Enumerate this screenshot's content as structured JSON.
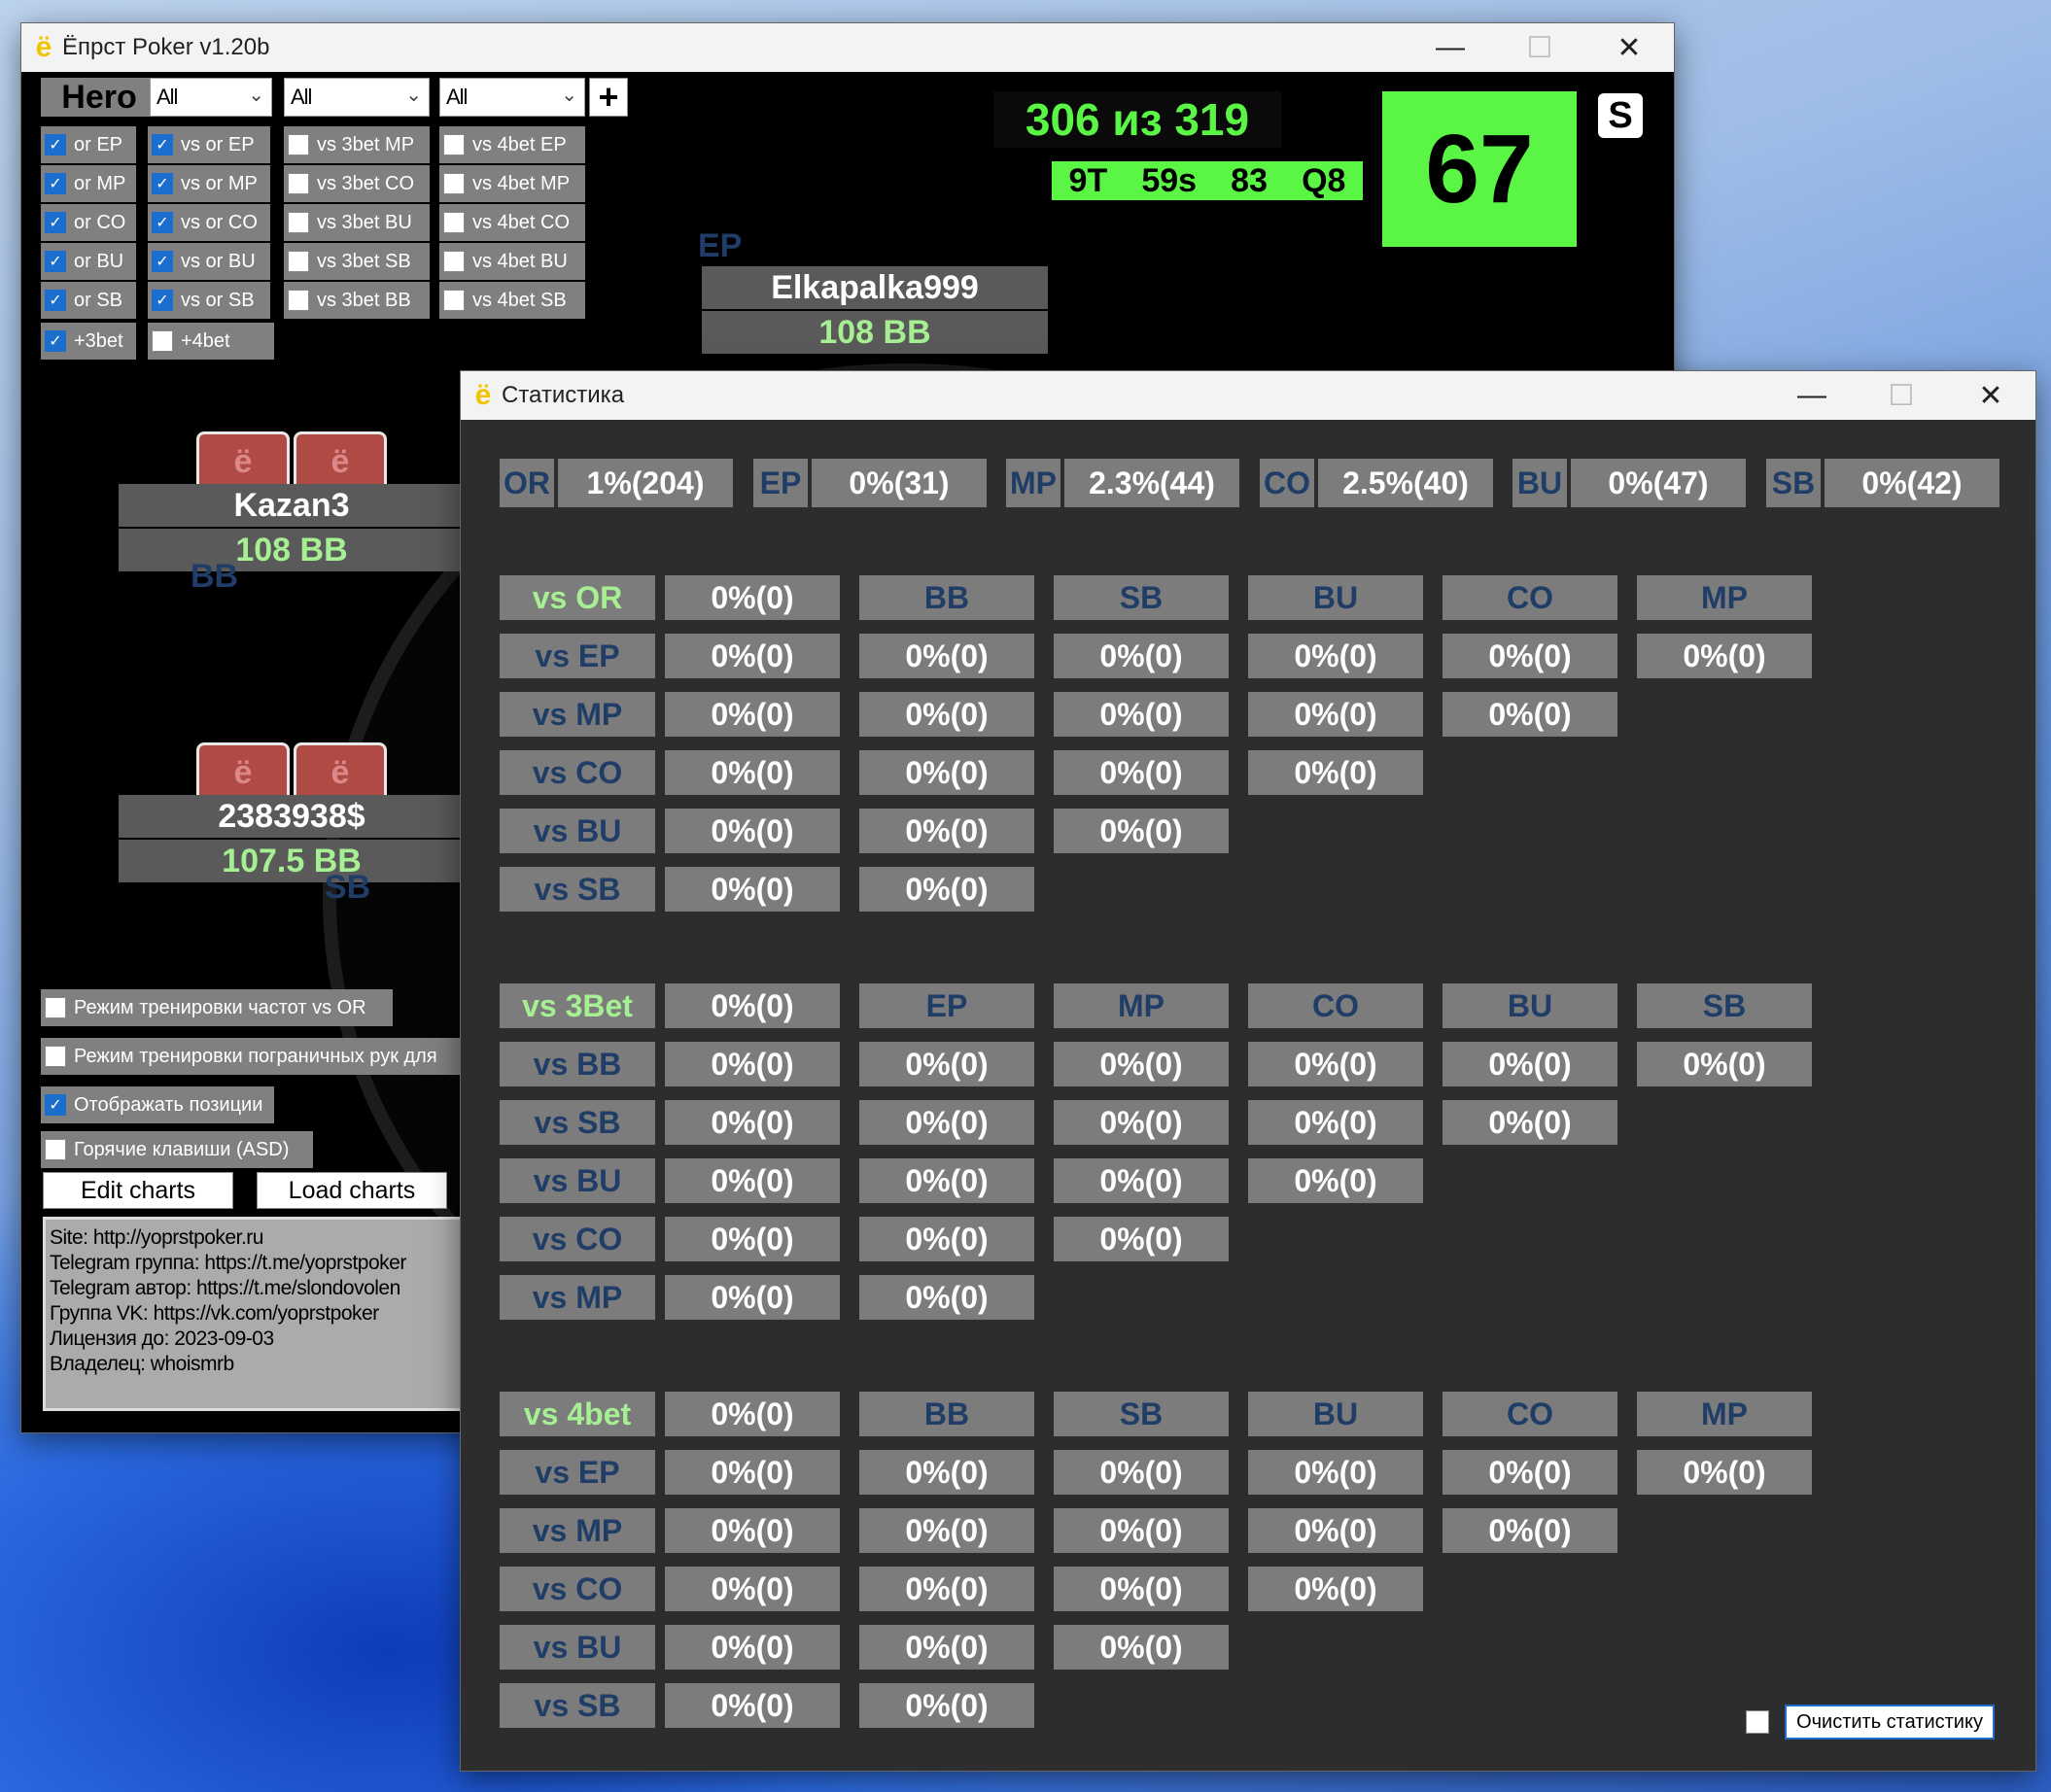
{
  "main_window": {
    "title": "Ёпрст Poker v1.20b",
    "hero_label": "Hero",
    "add_symbol": "+",
    "dropdowns": [
      "All",
      "All",
      "All"
    ],
    "col1": [
      {
        "label": "or EP",
        "checked": true
      },
      {
        "label": "or MP",
        "checked": true
      },
      {
        "label": "or CO",
        "checked": true
      },
      {
        "label": "or BU",
        "checked": true
      },
      {
        "label": "or SB",
        "checked": true
      }
    ],
    "col2": [
      {
        "label": "vs or EP",
        "checked": true
      },
      {
        "label": "vs or MP",
        "checked": true
      },
      {
        "label": "vs or CO",
        "checked": true
      },
      {
        "label": "vs or BU",
        "checked": true
      },
      {
        "label": "vs or SB",
        "checked": true
      }
    ],
    "col3": [
      {
        "label": "vs 3bet MP",
        "checked": false
      },
      {
        "label": "vs 3bet CO",
        "checked": false
      },
      {
        "label": "vs 3bet BU",
        "checked": false
      },
      {
        "label": "vs 3bet SB",
        "checked": false
      },
      {
        "label": "vs 3bet BB",
        "checked": false
      }
    ],
    "col4": [
      {
        "label": "vs 4bet EP",
        "checked": false
      },
      {
        "label": "vs 4bet MP",
        "checked": false
      },
      {
        "label": "vs 4bet CO",
        "checked": false
      },
      {
        "label": "vs 4bet BU",
        "checked": false
      },
      {
        "label": "vs 4bet SB",
        "checked": false
      }
    ],
    "extra": [
      {
        "label": "+3bet",
        "checked": true
      },
      {
        "label": "+4bet",
        "checked": false
      }
    ],
    "progress": "306 из 319",
    "hand_info": [
      "9T",
      "59s",
      "83",
      "Q8"
    ],
    "score": "67",
    "s_button": "S",
    "players": [
      {
        "name": "Elkapalka999",
        "stack": "108 BB",
        "position": "EP"
      },
      {
        "name": "Kazan3",
        "stack": "108 BB",
        "position": "BB"
      },
      {
        "name": "2383938$",
        "stack": "107.5 BB",
        "position": "SB"
      }
    ],
    "card_glyph": "ё",
    "options": [
      {
        "label": "Режим тренировки частот vs OR",
        "checked": false
      },
      {
        "label": "Режим тренировки пограничных рук для",
        "checked": false
      },
      {
        "label": "Отображать позиции",
        "checked": true
      },
      {
        "label": "Горячие клавиши (ASD)",
        "checked": false
      }
    ],
    "edit_charts": "Edit charts",
    "load_charts": "Load charts",
    "info_lines": [
      "Site: http://yoprstpoker.ru",
      "Telegram группа: https://t.me/yoprstpoker",
      "Telegram автор: https://t.me/slondovolen",
      "Группа VK: https://vk.com/yoprstpoker",
      "Лицензия до: 2023-09-03",
      "Владелец: whoismrb"
    ]
  },
  "stats_window": {
    "title": "Статистика",
    "summary": [
      {
        "pos": "OR",
        "val": "1%(204)"
      },
      {
        "pos": "EP",
        "val": "0%(31)"
      },
      {
        "pos": "MP",
        "val": "2.3%(44)"
      },
      {
        "pos": "CO",
        "val": "2.5%(40)"
      },
      {
        "pos": "BU",
        "val": "0%(47)"
      },
      {
        "pos": "SB",
        "val": "0%(42)"
      }
    ],
    "sections": [
      {
        "title": "vs OR",
        "total": "0%(0)",
        "headers": [
          "BB",
          "SB",
          "BU",
          "CO",
          "MP"
        ],
        "rows": [
          {
            "label": "vs EP",
            "vals": [
              "0%(0)",
              "0%(0)",
              "0%(0)",
              "0%(0)",
              "0%(0)",
              "0%(0)"
            ]
          },
          {
            "label": "vs MP",
            "vals": [
              "0%(0)",
              "0%(0)",
              "0%(0)",
              "0%(0)",
              "0%(0)"
            ]
          },
          {
            "label": "vs CO",
            "vals": [
              "0%(0)",
              "0%(0)",
              "0%(0)",
              "0%(0)"
            ]
          },
          {
            "label": "vs BU",
            "vals": [
              "0%(0)",
              "0%(0)",
              "0%(0)"
            ]
          },
          {
            "label": "vs SB",
            "vals": [
              "0%(0)",
              "0%(0)"
            ]
          }
        ]
      },
      {
        "title": "vs 3Bet",
        "total": "0%(0)",
        "headers": [
          "EP",
          "MP",
          "CO",
          "BU",
          "SB"
        ],
        "rows": [
          {
            "label": "vs BB",
            "vals": [
              "0%(0)",
              "0%(0)",
              "0%(0)",
              "0%(0)",
              "0%(0)",
              "0%(0)"
            ]
          },
          {
            "label": "vs SB",
            "vals": [
              "0%(0)",
              "0%(0)",
              "0%(0)",
              "0%(0)",
              "0%(0)"
            ]
          },
          {
            "label": "vs BU",
            "vals": [
              "0%(0)",
              "0%(0)",
              "0%(0)",
              "0%(0)"
            ]
          },
          {
            "label": "vs CO",
            "vals": [
              "0%(0)",
              "0%(0)",
              "0%(0)"
            ]
          },
          {
            "label": "vs MP",
            "vals": [
              "0%(0)",
              "0%(0)"
            ]
          }
        ]
      },
      {
        "title": "vs 4bet",
        "total": "0%(0)",
        "headers": [
          "BB",
          "SB",
          "BU",
          "CO",
          "MP"
        ],
        "rows": [
          {
            "label": "vs EP",
            "vals": [
              "0%(0)",
              "0%(0)",
              "0%(0)",
              "0%(0)",
              "0%(0)",
              "0%(0)"
            ]
          },
          {
            "label": "vs MP",
            "vals": [
              "0%(0)",
              "0%(0)",
              "0%(0)",
              "0%(0)",
              "0%(0)"
            ]
          },
          {
            "label": "vs CO",
            "vals": [
              "0%(0)",
              "0%(0)",
              "0%(0)",
              "0%(0)"
            ]
          },
          {
            "label": "vs BU",
            "vals": [
              "0%(0)",
              "0%(0)",
              "0%(0)"
            ]
          },
          {
            "label": "vs SB",
            "vals": [
              "0%(0)",
              "0%(0)"
            ]
          }
        ]
      }
    ],
    "clear_button": "Очистить статистику"
  },
  "window_controls": {
    "minimize": "—",
    "maximize": "☐",
    "close": "✕"
  },
  "colors": {
    "score_bg": "#5af545",
    "stat_label": "#1f3d66",
    "stat_green": "#a6f093"
  }
}
